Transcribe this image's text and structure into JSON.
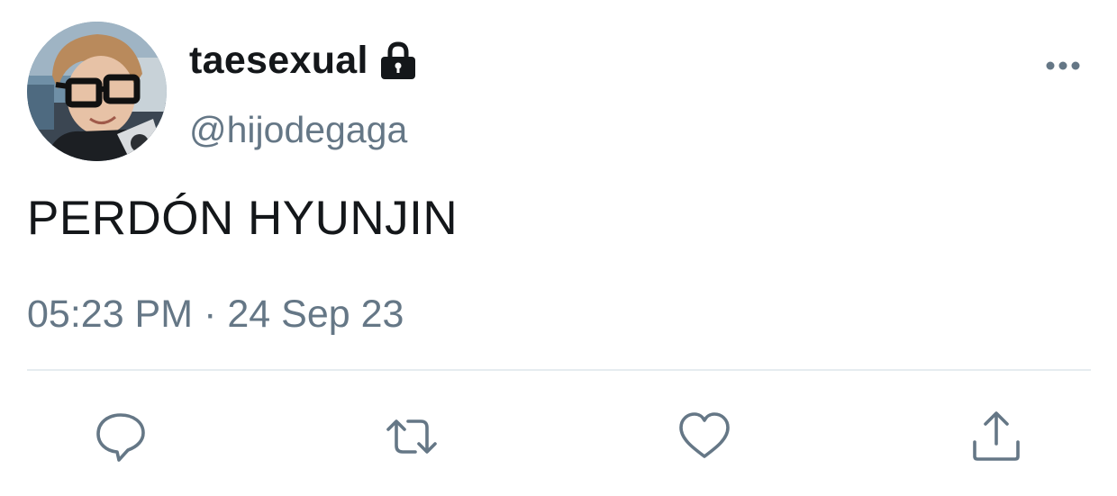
{
  "user": {
    "display_name": "taesexual",
    "handle": "@hijodegaga",
    "protected_icon": "lock-icon"
  },
  "tweet": {
    "text": "PERDÓN HYUNJIN",
    "time": "05:23 PM",
    "separator": "·",
    "date": "24 Sep 23"
  },
  "actions": {
    "reply_icon": "reply-icon",
    "retweet_icon": "retweet-icon",
    "like_icon": "heart-icon",
    "share_icon": "share-icon",
    "more_icon": "more-icon"
  },
  "colors": {
    "text_primary": "#14171a",
    "text_secondary": "#657786",
    "icon": "#657786",
    "divider": "#e6ecf0"
  }
}
